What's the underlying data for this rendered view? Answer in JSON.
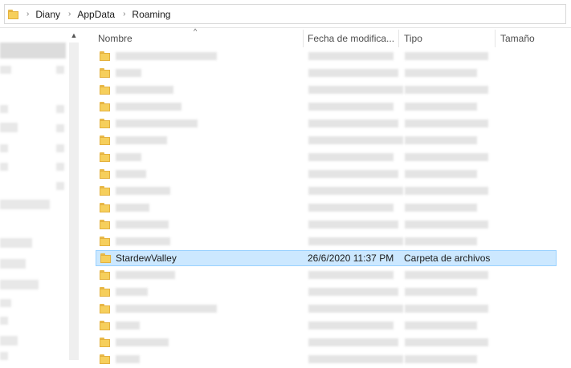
{
  "breadcrumb": {
    "items": [
      "Diany",
      "AppData",
      "Roaming"
    ],
    "separator": "›"
  },
  "columns": {
    "name": "Nombre",
    "date": "Fecha de modifica...",
    "type": "Tipo",
    "size": "Tamaño"
  },
  "selected_item": {
    "name": "StardewValley",
    "date": "26/6/2020 11:37 PM",
    "type": "Carpeta de archivos",
    "size": ""
  },
  "colors": {
    "selection_bg": "#cce8ff",
    "selection_border": "#99d1ff",
    "folder": "#f6cf5c"
  }
}
